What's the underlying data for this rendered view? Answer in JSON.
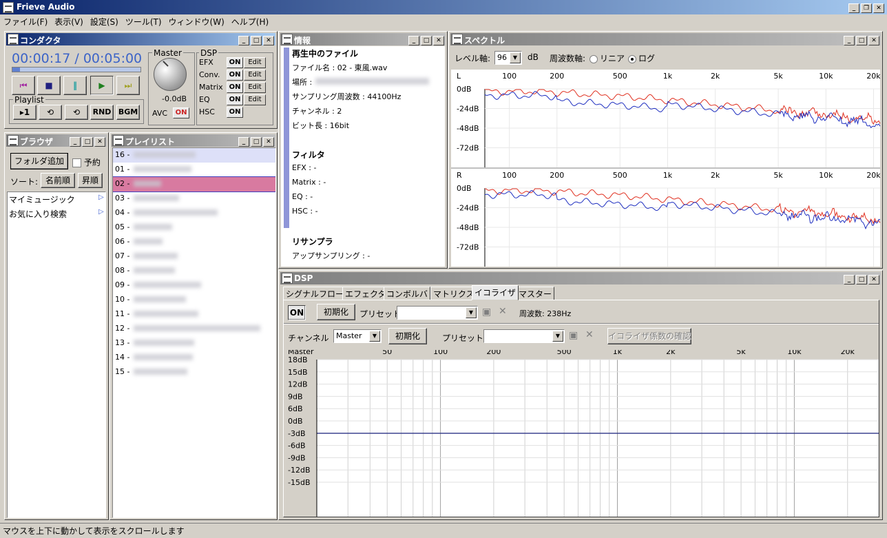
{
  "app": {
    "title": "Frieve Audio"
  },
  "menu": [
    "ファイル(F)",
    "表示(V)",
    "設定(S)",
    "ツール(T)",
    "ウィンドウ(W)",
    "ヘルプ(H)"
  ],
  "conductor": {
    "title": "コンダクタ",
    "time": "00:00:17 / 00:05:00",
    "master_label": "Master",
    "volume": "-0.0dB",
    "avc_label": "AVC",
    "avc_state": "ON",
    "playlist_label": "Playlist",
    "playlist_buttons": [
      "▸1",
      "⟲",
      "⟲",
      "RND",
      "BGM"
    ],
    "dsp_label": "DSP",
    "dsp_rows": [
      {
        "name": "EFX",
        "state": "ON",
        "edit": "Edit"
      },
      {
        "name": "Conv.",
        "state": "ON",
        "edit": "Edit"
      },
      {
        "name": "Matrix",
        "state": "ON",
        "edit": "Edit"
      },
      {
        "name": "EQ",
        "state": "ON",
        "edit": "Edit"
      },
      {
        "name": "HSC",
        "state": "ON"
      }
    ]
  },
  "info": {
    "title": "情報",
    "now_playing_heading": "再生中のファイル",
    "filename": "ファイル名 : 02 - 東風.wav",
    "location": "場所 :",
    "sampling": "サンプリング周波数 : 44100Hz",
    "channels": "チャンネル : 2",
    "bits": "ビット長 : 16bit",
    "filter_heading": "フィルタ",
    "efx": "EFX : -",
    "matrix": "Matrix : -",
    "eq": "EQ : -",
    "hsc": "HSC : -",
    "resampler_heading": "リサンプラ",
    "upsampling": "アップサンプリング : -"
  },
  "spectrum": {
    "title": "スペクトル",
    "level_axis_label": "レベル軸:",
    "level_value": "96",
    "db_unit": "dB",
    "freq_axis_label": "周波数軸:",
    "linear_label": "リニア",
    "log_label": "ログ",
    "log_selected": true,
    "freq_ticks": [
      "100",
      "200",
      "500",
      "1k",
      "2k",
      "5k",
      "10k",
      "20k"
    ],
    "db_ticks": [
      "0dB",
      "-24dB",
      "-48dB",
      "-72dB"
    ],
    "channels": [
      "L",
      "R"
    ]
  },
  "browser": {
    "title": "ブラウザ",
    "add_folder": "フォルダ追加",
    "reserve": "予約",
    "sort_label": "ソート:",
    "sort_name": "名前順",
    "sort_order": "昇順",
    "items": [
      "マイミュージック",
      "お気に入り検索"
    ]
  },
  "playlist": {
    "title": "プレイリスト",
    "rows": [
      "16 -",
      "01 -",
      "02 -",
      "03 -",
      "04 -",
      "05 -",
      "06 -",
      "07 -",
      "08 -",
      "09 -",
      "10 -",
      "11 -",
      "12 -",
      "13 -",
      "14 -",
      "15 -"
    ]
  },
  "dsp": {
    "title": "DSP",
    "tabs": [
      "シグナルフロー",
      "エフェクタ",
      "コンボルバ",
      "マトリクス",
      "イコライザ",
      "マスター"
    ],
    "active_tab": "イコライザ",
    "on": "ON",
    "init": "初期化",
    "preset_label": "プリセット:",
    "freq_label": "周波数: 238Hz",
    "channel_label": "チャンネル",
    "channel_value": "Master",
    "init2": "初期化",
    "preset_label2": "プリセット:",
    "confirm": "イコライザ係数の確認",
    "graph_label": "Master",
    "freq_ticks": [
      "50",
      "100",
      "200",
      "500",
      "1k",
      "2k",
      "5k",
      "10k",
      "20k"
    ],
    "db_ticks": [
      "18dB",
      "15dB",
      "12dB",
      "9dB",
      "6dB",
      "0dB",
      "-3dB",
      "-6dB",
      "-9dB",
      "-12dB",
      "-15dB"
    ]
  },
  "status": "マウスを上下に動かして表示をスクロールします",
  "colors": {
    "title_active": "#0a246a",
    "time": "#3c64c8",
    "avc_on": "#cc2222",
    "spectrum_red": "#e03020",
    "spectrum_blue": "#2030c0",
    "eq_line": "#1a237e"
  }
}
